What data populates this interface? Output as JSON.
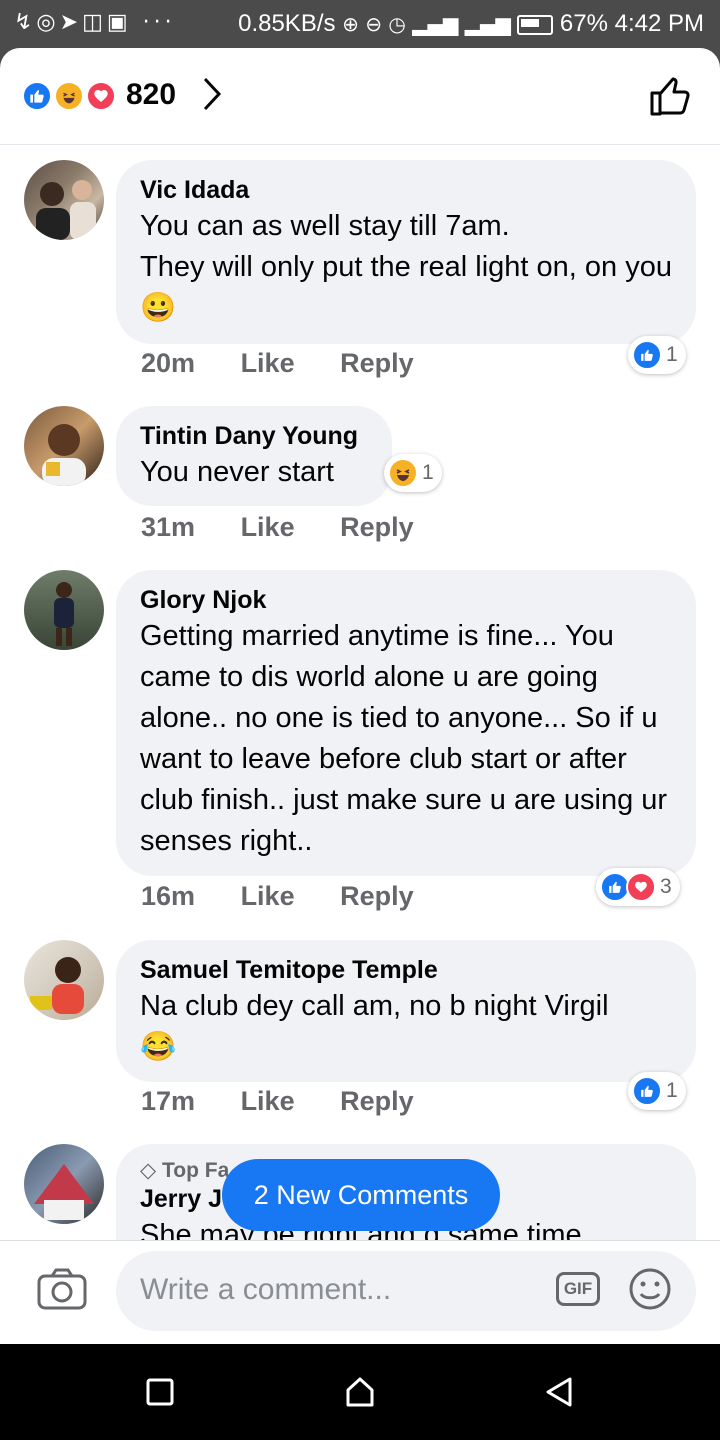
{
  "status_bar": {
    "left_icons": "↯◎➤◫▣ ···",
    "net_speed": "0.85KB/s",
    "battery": "67%",
    "time": "4:42 PM"
  },
  "header": {
    "reaction_count": "820",
    "reaction_icons": [
      "like-icon",
      "haha-icon",
      "love-icon"
    ]
  },
  "comments": [
    {
      "author": "Vic Idada",
      "text": "You can as well stay till 7am.\nThey will only put the real light on, on you😀",
      "time": "20m",
      "like_label": "Like",
      "reply_label": "Reply",
      "reaction_count": "1"
    },
    {
      "author": "Tintin Dany Young",
      "text": "You never start",
      "time": "31m",
      "like_label": "Like",
      "reply_label": "Reply",
      "reaction_count": "1"
    },
    {
      "author": "Glory Njok",
      "text": "Getting married anytime is fine... You came to dis world alone u are going alone.. no one is tied to anyone... So if u want to leave before club start or after club finish.. just make sure u are using ur senses right..",
      "time": "16m",
      "like_label": "Like",
      "reply_label": "Reply",
      "reaction_count": "3"
    },
    {
      "author": "Samuel Temitope Temple",
      "text": "Na club dey call am, no b night Virgil\n😂",
      "time": "17m",
      "like_label": "Like",
      "reply_label": "Reply",
      "reaction_count": "1"
    },
    {
      "badge": "Top Fa",
      "author": "Jerry J",
      "text": "She may be right and d same time"
    }
  ],
  "new_comments_label": "2 New Comments",
  "composer": {
    "placeholder": "Write a comment...",
    "gif_label": "GIF"
  },
  "colors": {
    "brand_blue": "#1877f2",
    "love_red": "#f33e58",
    "haha_yellow": "#f7b125",
    "bubble_gray": "#f0f2f5"
  }
}
